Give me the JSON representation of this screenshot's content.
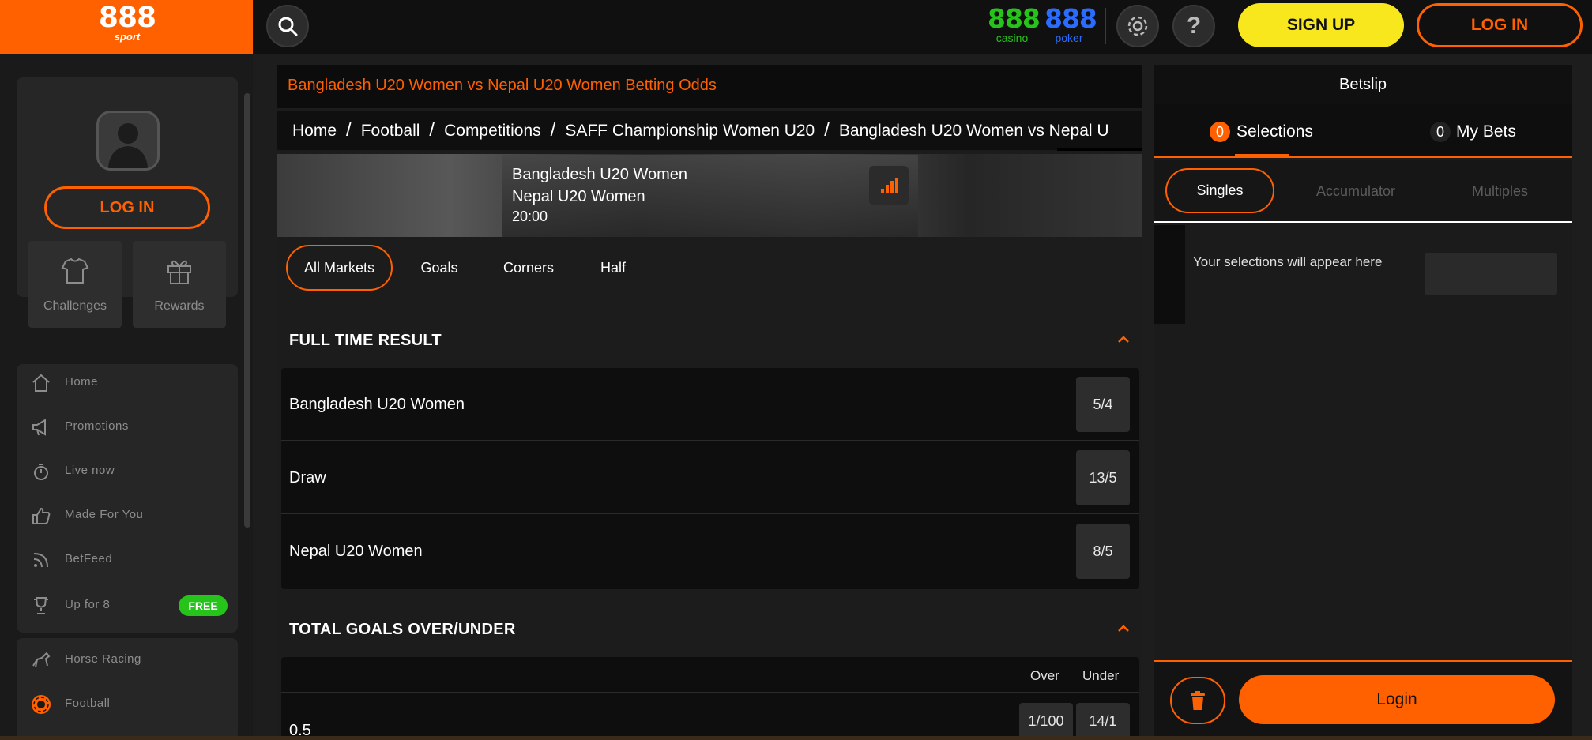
{
  "brand": {
    "logo": "888",
    "logo_sub": "sport"
  },
  "header": {
    "search_icon": "search-icon",
    "casino": {
      "num": "888",
      "word": "casino",
      "color": "#26c41a"
    },
    "poker": {
      "num": "888",
      "word": "poker",
      "color": "#2a6cff"
    },
    "settings_icon": "gear-icon",
    "help_icon": "question-icon",
    "signup_label": "SIGN UP",
    "login_label": "LOG IN"
  },
  "sidebar": {
    "login_label": "LOG IN",
    "tiles": [
      {
        "label": "Challenges",
        "icon": "shirt-icon"
      },
      {
        "label": "Rewards",
        "icon": "gift-icon"
      }
    ],
    "menu": [
      {
        "label": "Home",
        "icon": "home-icon"
      },
      {
        "label": "Promotions",
        "icon": "megaphone-icon"
      },
      {
        "label": "Live now",
        "icon": "stopwatch-icon"
      },
      {
        "label": "Made For You",
        "icon": "thumbs-up-icon"
      },
      {
        "label": "BetFeed",
        "icon": "feed-icon"
      },
      {
        "label": "Up for 8",
        "icon": "trophy-icon",
        "badge": "FREE"
      }
    ],
    "sports": [
      {
        "label": "Horse Racing",
        "icon": "horse-icon"
      },
      {
        "label": "Football",
        "icon": "football-icon"
      }
    ]
  },
  "main": {
    "title": "Bangladesh U20 Women vs Nepal U20 Women Betting Odds",
    "breadcrumb": [
      "Home",
      "Football",
      "Competitions",
      "SAFF Championship Women U20",
      "Bangladesh U20 Women vs Nepal U"
    ],
    "event": {
      "home": "Bangladesh U20 Women",
      "away": "Nepal U20 Women",
      "time": "20:00"
    },
    "tabs": [
      "All Markets",
      "Goals",
      "Corners",
      "Half"
    ],
    "full_time": {
      "heading": "FULL TIME RESULT",
      "rows": [
        {
          "name": "Bangladesh U20 Women",
          "odds": "5/4"
        },
        {
          "name": "Draw",
          "odds": "13/5"
        },
        {
          "name": "Nepal U20 Women",
          "odds": "8/5"
        }
      ]
    },
    "total_goals": {
      "heading": "TOTAL GOALS OVER/UNDER",
      "col_over": "Over",
      "col_under": "Under",
      "rows": [
        {
          "line": "0.5",
          "over": "1/100",
          "under": "14/1"
        }
      ]
    }
  },
  "betslip": {
    "title": "Betslip",
    "selections_count": "0",
    "selections_label": "Selections",
    "mybets_count": "0",
    "mybets_label": "My Bets",
    "subtabs": [
      "Singles",
      "Accumulator",
      "Multiples"
    ],
    "empty_text": "Your selections will appear here",
    "login_label": "Login"
  },
  "colors": {
    "accent": "#ff6000",
    "signup": "#f8e71c",
    "free": "#26c41a"
  }
}
